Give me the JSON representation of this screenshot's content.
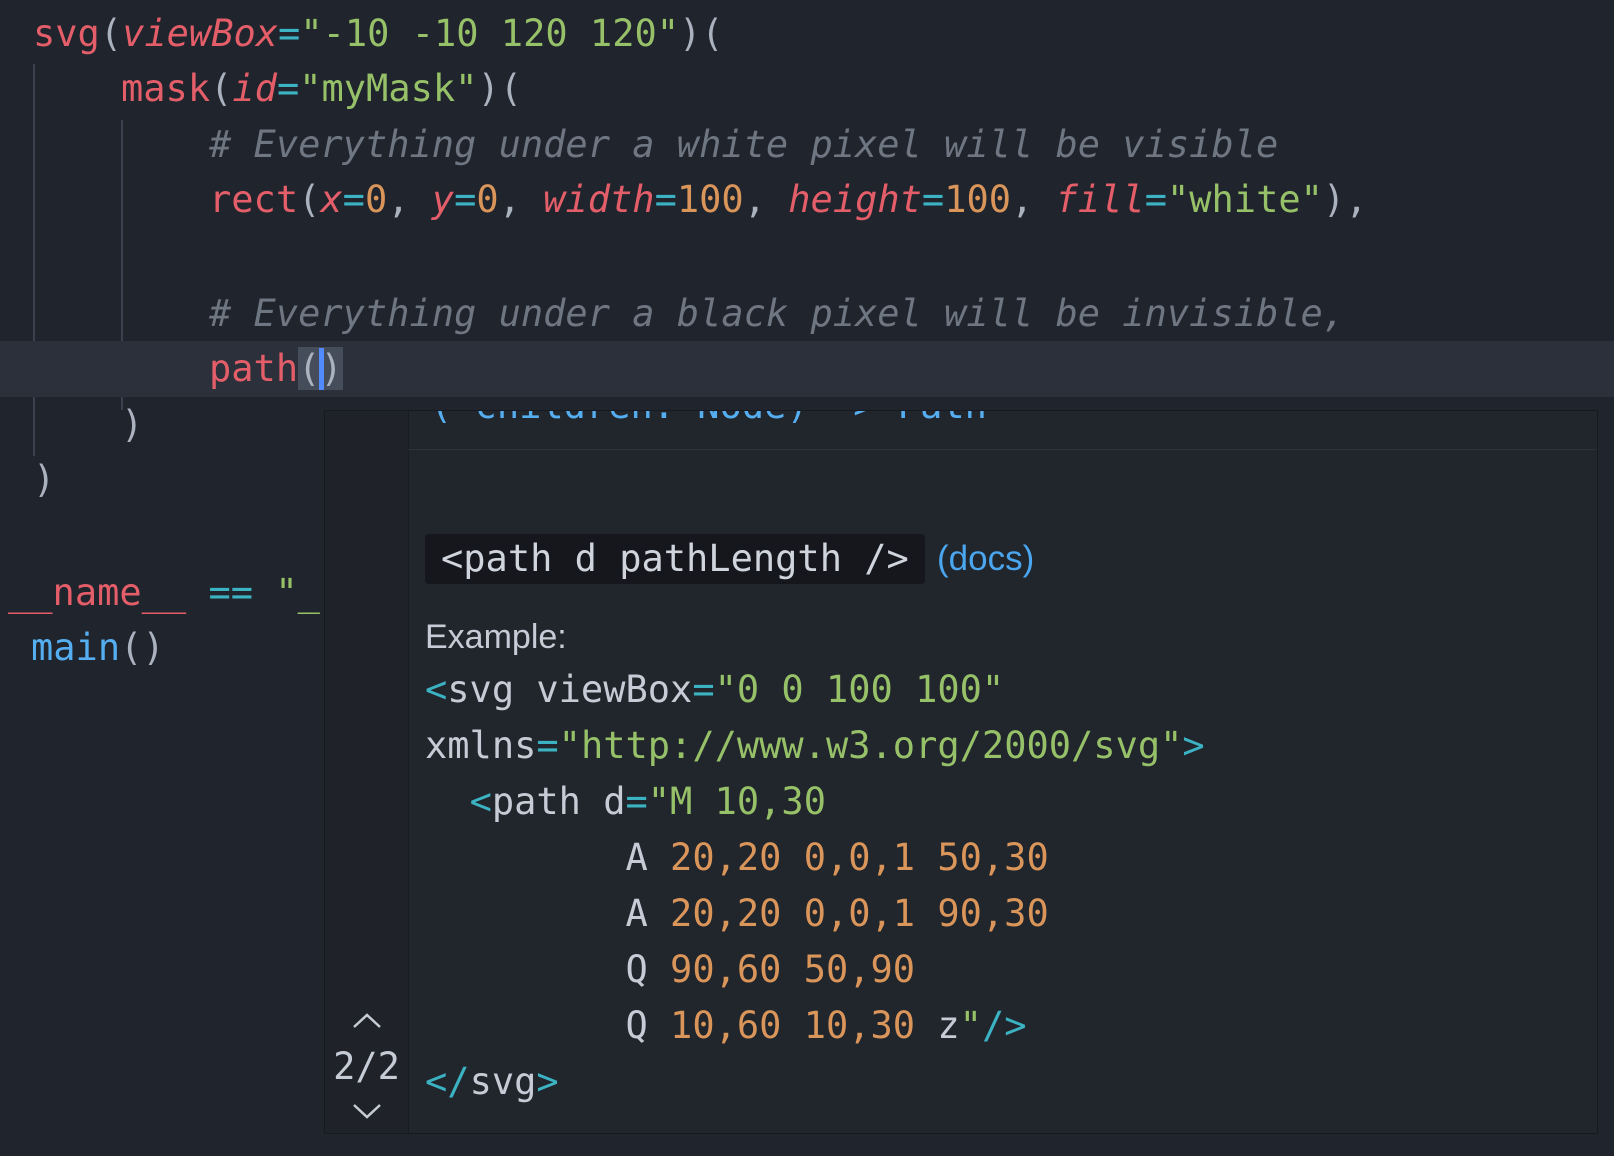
{
  "editor": {
    "lines": [
      {
        "tokens": [
          [
            "fn",
            "svg"
          ],
          [
            "punct",
            "("
          ],
          [
            "attr",
            "viewBox"
          ],
          [
            "op",
            "="
          ],
          [
            "str",
            "\"-10 -10 120 120\""
          ],
          [
            "punct",
            ")("
          ]
        ]
      },
      {
        "tokens": [
          [
            "fn",
            "mask"
          ],
          [
            "punct",
            "("
          ],
          [
            "attr",
            "id"
          ],
          [
            "op",
            "="
          ],
          [
            "str",
            "\"myMask\""
          ],
          [
            "punct",
            ")("
          ]
        ]
      },
      {
        "tokens": [
          [
            "comment",
            "# Everything under a white pixel will be visible"
          ]
        ]
      },
      {
        "tokens": [
          [
            "fn",
            "rect"
          ],
          [
            "punct",
            "("
          ],
          [
            "attr",
            "x"
          ],
          [
            "op",
            "="
          ],
          [
            "num",
            "0"
          ],
          [
            "punct",
            ", "
          ],
          [
            "attr",
            "y"
          ],
          [
            "op",
            "="
          ],
          [
            "num",
            "0"
          ],
          [
            "punct",
            ", "
          ],
          [
            "attr",
            "width"
          ],
          [
            "op",
            "="
          ],
          [
            "num",
            "100"
          ],
          [
            "punct",
            ", "
          ],
          [
            "attr",
            "height"
          ],
          [
            "op",
            "="
          ],
          [
            "num",
            "100"
          ],
          [
            "punct",
            ", "
          ],
          [
            "attr",
            "fill"
          ],
          [
            "op",
            "="
          ],
          [
            "str",
            "\"white\""
          ],
          [
            "punct",
            "),"
          ]
        ]
      },
      {
        "tokens": []
      },
      {
        "tokens": [
          [
            "comment",
            "# Everything under a black pixel will be invisible,"
          ]
        ]
      },
      {
        "tokens": [
          [
            "fn",
            "path"
          ],
          [
            "paren",
            "("
          ],
          [
            "cursor",
            ""
          ],
          [
            "paren",
            ")"
          ]
        ]
      },
      {
        "tokens": [
          [
            "punct",
            ")"
          ]
        ]
      },
      {
        "tokens": [
          [
            "punct",
            ")"
          ]
        ]
      },
      {
        "tokens": []
      },
      {
        "tokens": [
          [
            "fn",
            "__name__"
          ],
          [
            "punct",
            " "
          ],
          [
            "op",
            "=="
          ],
          [
            "punct",
            " "
          ],
          [
            "str",
            "\"_"
          ]
        ]
      },
      {
        "tokens": [
          [
            "blue",
            "main"
          ],
          [
            "punct",
            "()"
          ]
        ]
      }
    ]
  },
  "popup": {
    "signature_clipped": "(*children: Node) -> Path",
    "pager_count": "2/2",
    "doc_signature": "<path d pathLength />",
    "docs_link": "(docs)",
    "example_label": "Example:",
    "example_lines": [
      {
        "tokens": [
          [
            "op",
            "<"
          ],
          [
            "text",
            "svg viewBox"
          ],
          [
            "op",
            "="
          ],
          [
            "str",
            "\"0 0 100 100\""
          ]
        ]
      },
      {
        "tokens": [
          [
            "text",
            "xmlns"
          ],
          [
            "op",
            "="
          ],
          [
            "str",
            "\"http://www.w3.org/2000/svg\""
          ],
          [
            "op",
            ">"
          ]
        ]
      },
      {
        "tokens": [
          [
            "text",
            "  "
          ],
          [
            "op",
            "<"
          ],
          [
            "text",
            "path d"
          ],
          [
            "op",
            "="
          ],
          [
            "str",
            "\"M 10,30"
          ]
        ]
      },
      {
        "tokens": [
          [
            "text",
            "         A "
          ],
          [
            "num",
            "20,20 0,0,1 50,30"
          ]
        ]
      },
      {
        "tokens": [
          [
            "text",
            "         A "
          ],
          [
            "num",
            "20,20 0,0,1 90,30"
          ]
        ]
      },
      {
        "tokens": [
          [
            "text",
            "         Q "
          ],
          [
            "num",
            "90,60 50,90"
          ]
        ]
      },
      {
        "tokens": [
          [
            "text",
            "         Q "
          ],
          [
            "num",
            "10,60 10,30"
          ],
          [
            "text",
            " z"
          ],
          [
            "str",
            "\""
          ],
          [
            "op",
            "/>"
          ]
        ]
      },
      {
        "tokens": [
          [
            "op",
            "</"
          ],
          [
            "text",
            "svg"
          ],
          [
            "op",
            ">"
          ]
        ]
      }
    ]
  },
  "colors": {
    "background": "#20242c",
    "current_line": "#2b303a",
    "cursor": "#528bff",
    "function": "#e45e6a",
    "string": "#97c169",
    "number": "#d9955a",
    "operator": "#3bb3c3",
    "comment": "#6e7682",
    "link": "#4aa6ef"
  }
}
